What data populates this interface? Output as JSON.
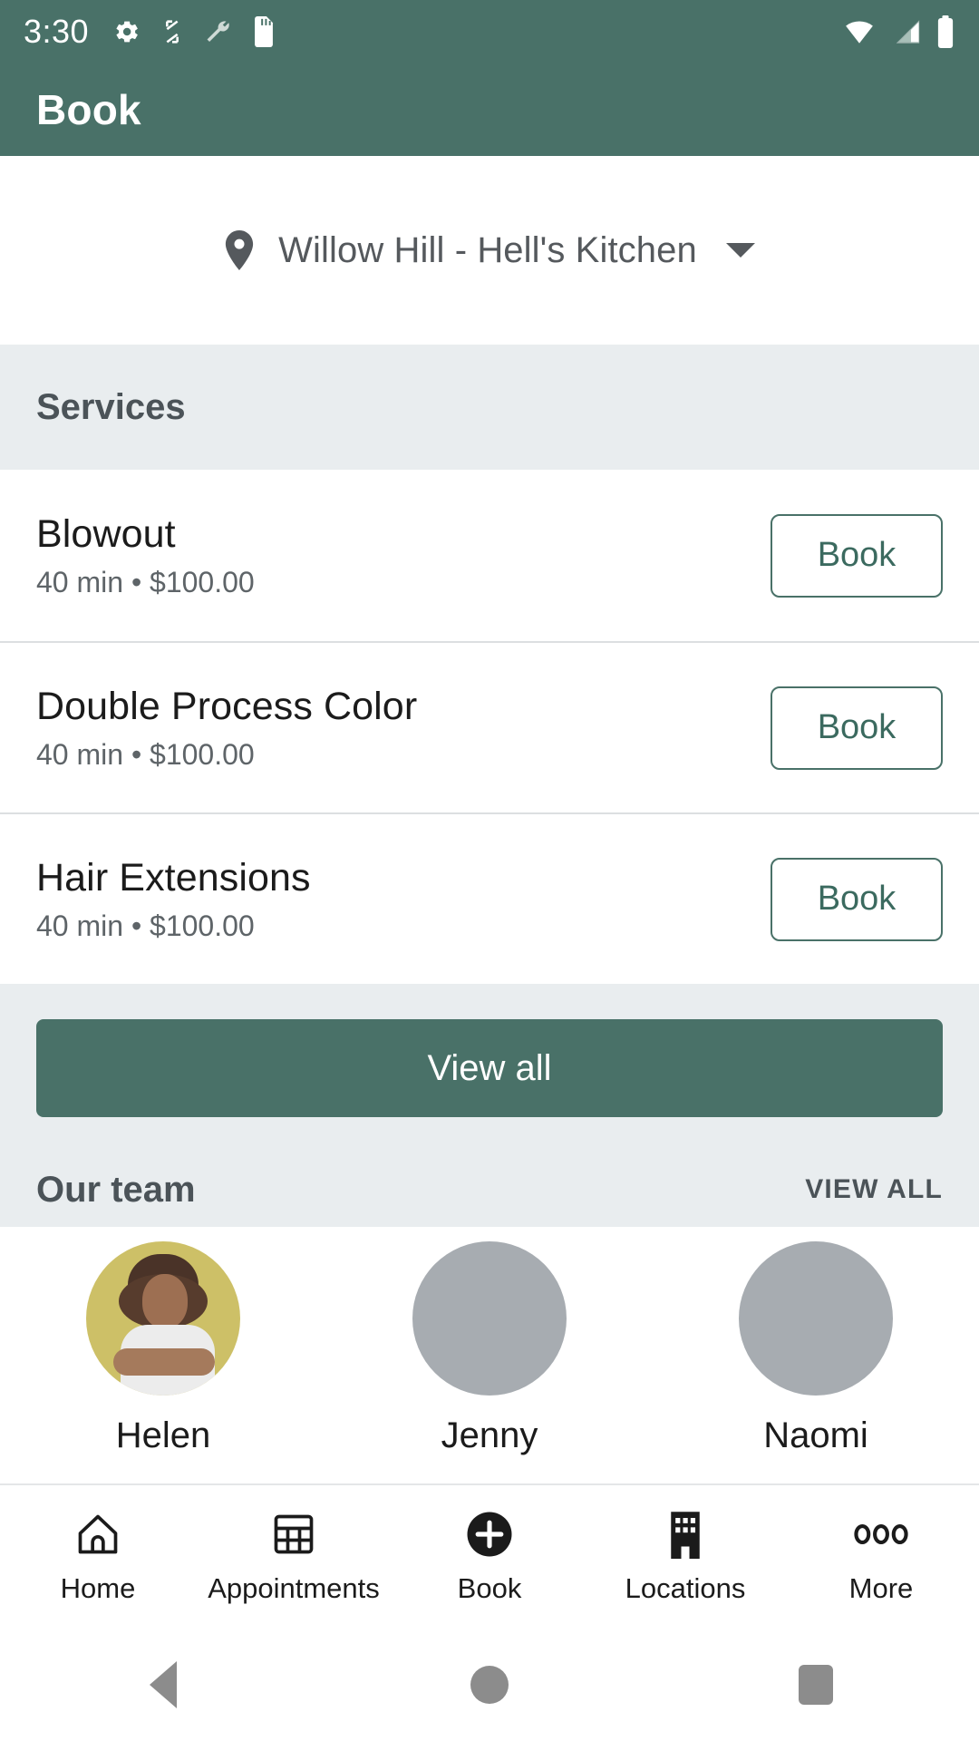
{
  "status_bar": {
    "time": "3:30",
    "left_icons": [
      "gear-icon",
      "resize-icon",
      "wrench-icon",
      "sdcard-icon"
    ],
    "right_icons": [
      "wifi-icon",
      "cellular-signal-icon",
      "battery-icon"
    ]
  },
  "app_bar": {
    "title": "Book"
  },
  "location": {
    "icon": "map-pin-icon",
    "name": "Willow Hill - Hell's Kitchen",
    "caret": "chevron-down-icon"
  },
  "services_section": {
    "title": "Services",
    "items": [
      {
        "name": "Blowout",
        "meta": "40 min • $100.00",
        "button": "Book"
      },
      {
        "name": "Double Process Color",
        "meta": "40 min • $100.00",
        "button": "Book"
      },
      {
        "name": "Hair Extensions",
        "meta": "40 min • $100.00",
        "button": "Book"
      }
    ],
    "view_all_button": "View all"
  },
  "team_section": {
    "title": "Our team",
    "view_all_link": "VIEW ALL",
    "members": [
      {
        "name": "Helen",
        "avatar": "photo"
      },
      {
        "name": "Jenny",
        "avatar": "placeholder"
      },
      {
        "name": "Naomi",
        "avatar": "placeholder"
      }
    ]
  },
  "bottom_nav": {
    "items": [
      {
        "label": "Home",
        "icon": "home-icon",
        "active": false
      },
      {
        "label": "Appointments",
        "icon": "calendar-grid-icon",
        "active": false
      },
      {
        "label": "Book",
        "icon": "plus-circle-icon",
        "active": true
      },
      {
        "label": "Locations",
        "icon": "building-icon",
        "active": false
      },
      {
        "label": "More",
        "icon": "more-dots-icon",
        "active": false
      }
    ]
  },
  "system_nav": {
    "back": "back-triangle-icon",
    "home": "home-circle-icon",
    "recents": "recents-square-icon"
  },
  "colors": {
    "brand_green": "#497168",
    "band_gray": "#e9edef",
    "text_dark": "#1b1b1b"
  }
}
